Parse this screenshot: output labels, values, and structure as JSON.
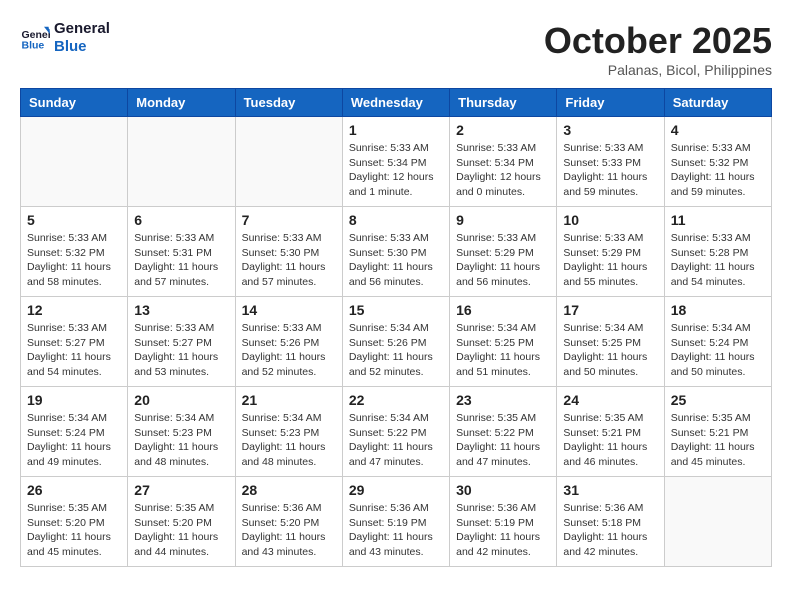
{
  "logo": {
    "line1": "General",
    "line2": "Blue"
  },
  "title": "October 2025",
  "subtitle": "Palanas, Bicol, Philippines",
  "days_of_week": [
    "Sunday",
    "Monday",
    "Tuesday",
    "Wednesday",
    "Thursday",
    "Friday",
    "Saturday"
  ],
  "weeks": [
    [
      {
        "day": "",
        "info": ""
      },
      {
        "day": "",
        "info": ""
      },
      {
        "day": "",
        "info": ""
      },
      {
        "day": "1",
        "info": "Sunrise: 5:33 AM\nSunset: 5:34 PM\nDaylight: 12 hours\nand 1 minute."
      },
      {
        "day": "2",
        "info": "Sunrise: 5:33 AM\nSunset: 5:34 PM\nDaylight: 12 hours\nand 0 minutes."
      },
      {
        "day": "3",
        "info": "Sunrise: 5:33 AM\nSunset: 5:33 PM\nDaylight: 11 hours\nand 59 minutes."
      },
      {
        "day": "4",
        "info": "Sunrise: 5:33 AM\nSunset: 5:32 PM\nDaylight: 11 hours\nand 59 minutes."
      }
    ],
    [
      {
        "day": "5",
        "info": "Sunrise: 5:33 AM\nSunset: 5:32 PM\nDaylight: 11 hours\nand 58 minutes."
      },
      {
        "day": "6",
        "info": "Sunrise: 5:33 AM\nSunset: 5:31 PM\nDaylight: 11 hours\nand 57 minutes."
      },
      {
        "day": "7",
        "info": "Sunrise: 5:33 AM\nSunset: 5:30 PM\nDaylight: 11 hours\nand 57 minutes."
      },
      {
        "day": "8",
        "info": "Sunrise: 5:33 AM\nSunset: 5:30 PM\nDaylight: 11 hours\nand 56 minutes."
      },
      {
        "day": "9",
        "info": "Sunrise: 5:33 AM\nSunset: 5:29 PM\nDaylight: 11 hours\nand 56 minutes."
      },
      {
        "day": "10",
        "info": "Sunrise: 5:33 AM\nSunset: 5:29 PM\nDaylight: 11 hours\nand 55 minutes."
      },
      {
        "day": "11",
        "info": "Sunrise: 5:33 AM\nSunset: 5:28 PM\nDaylight: 11 hours\nand 54 minutes."
      }
    ],
    [
      {
        "day": "12",
        "info": "Sunrise: 5:33 AM\nSunset: 5:27 PM\nDaylight: 11 hours\nand 54 minutes."
      },
      {
        "day": "13",
        "info": "Sunrise: 5:33 AM\nSunset: 5:27 PM\nDaylight: 11 hours\nand 53 minutes."
      },
      {
        "day": "14",
        "info": "Sunrise: 5:33 AM\nSunset: 5:26 PM\nDaylight: 11 hours\nand 52 minutes."
      },
      {
        "day": "15",
        "info": "Sunrise: 5:34 AM\nSunset: 5:26 PM\nDaylight: 11 hours\nand 52 minutes."
      },
      {
        "day": "16",
        "info": "Sunrise: 5:34 AM\nSunset: 5:25 PM\nDaylight: 11 hours\nand 51 minutes."
      },
      {
        "day": "17",
        "info": "Sunrise: 5:34 AM\nSunset: 5:25 PM\nDaylight: 11 hours\nand 50 minutes."
      },
      {
        "day": "18",
        "info": "Sunrise: 5:34 AM\nSunset: 5:24 PM\nDaylight: 11 hours\nand 50 minutes."
      }
    ],
    [
      {
        "day": "19",
        "info": "Sunrise: 5:34 AM\nSunset: 5:24 PM\nDaylight: 11 hours\nand 49 minutes."
      },
      {
        "day": "20",
        "info": "Sunrise: 5:34 AM\nSunset: 5:23 PM\nDaylight: 11 hours\nand 48 minutes."
      },
      {
        "day": "21",
        "info": "Sunrise: 5:34 AM\nSunset: 5:23 PM\nDaylight: 11 hours\nand 48 minutes."
      },
      {
        "day": "22",
        "info": "Sunrise: 5:34 AM\nSunset: 5:22 PM\nDaylight: 11 hours\nand 47 minutes."
      },
      {
        "day": "23",
        "info": "Sunrise: 5:35 AM\nSunset: 5:22 PM\nDaylight: 11 hours\nand 47 minutes."
      },
      {
        "day": "24",
        "info": "Sunrise: 5:35 AM\nSunset: 5:21 PM\nDaylight: 11 hours\nand 46 minutes."
      },
      {
        "day": "25",
        "info": "Sunrise: 5:35 AM\nSunset: 5:21 PM\nDaylight: 11 hours\nand 45 minutes."
      }
    ],
    [
      {
        "day": "26",
        "info": "Sunrise: 5:35 AM\nSunset: 5:20 PM\nDaylight: 11 hours\nand 45 minutes."
      },
      {
        "day": "27",
        "info": "Sunrise: 5:35 AM\nSunset: 5:20 PM\nDaylight: 11 hours\nand 44 minutes."
      },
      {
        "day": "28",
        "info": "Sunrise: 5:36 AM\nSunset: 5:20 PM\nDaylight: 11 hours\nand 43 minutes."
      },
      {
        "day": "29",
        "info": "Sunrise: 5:36 AM\nSunset: 5:19 PM\nDaylight: 11 hours\nand 43 minutes."
      },
      {
        "day": "30",
        "info": "Sunrise: 5:36 AM\nSunset: 5:19 PM\nDaylight: 11 hours\nand 42 minutes."
      },
      {
        "day": "31",
        "info": "Sunrise: 5:36 AM\nSunset: 5:18 PM\nDaylight: 11 hours\nand 42 minutes."
      },
      {
        "day": "",
        "info": ""
      }
    ]
  ]
}
